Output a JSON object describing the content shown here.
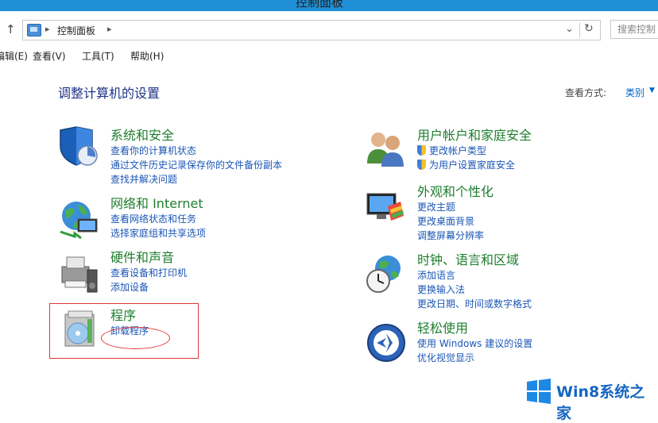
{
  "window": {
    "title": "控制面板"
  },
  "address": {
    "crumb": "控制面板",
    "search_placeholder": "搜索控制"
  },
  "menu": [
    "编辑(E)",
    "查看(V)",
    "工具(T)",
    "帮助(H)"
  ],
  "header": {
    "title": "调整计算机的设置",
    "view_label": "查看方式:",
    "view_value": "类别"
  },
  "left": [
    {
      "title": "系统和安全",
      "links": [
        "查看你的计算机状态",
        "通过文件历史记录保存你的文件备份副本",
        "查找并解决问题"
      ]
    },
    {
      "title": "网络和 Internet",
      "links": [
        "查看网络状态和任务",
        "选择家庭组和共享选项"
      ]
    },
    {
      "title": "硬件和声音",
      "links": [
        "查看设备和打印机",
        "添加设备"
      ]
    },
    {
      "title": "程序",
      "links": [
        "卸载程序"
      ]
    }
  ],
  "right": [
    {
      "title": "用户帐户和家庭安全",
      "links": [
        "更改帐户类型",
        "为用户设置家庭安全"
      ]
    },
    {
      "title": "外观和个性化",
      "links": [
        "更改主题",
        "更改桌面背景",
        "调整屏幕分辨率"
      ]
    },
    {
      "title": "时钟、语言和区域",
      "links": [
        "添加语言",
        "更换输入法",
        "更改日期、时间或数字格式"
      ]
    },
    {
      "title": "轻松使用",
      "links": [
        "使用 Windows 建议的设置",
        "优化视觉显示"
      ]
    }
  ],
  "watermark": {
    "text": "Win8系统之家"
  },
  "colors": {
    "title_bar": "#1f8fd6",
    "category_title": "#1e7e2e",
    "link": "#1a56b5",
    "page_title": "#1e3287",
    "highlight": "#e0363a"
  }
}
